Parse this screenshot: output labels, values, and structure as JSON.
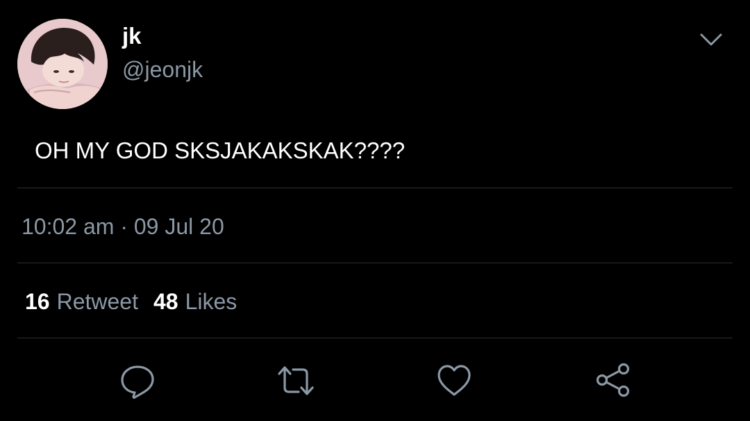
{
  "user": {
    "display_name": "jk",
    "handle": "@jeonjk",
    "avatar_icon": "profile-photo"
  },
  "tweet": {
    "text": "OH MY GOD SKSJAKAKSKAK????"
  },
  "meta": {
    "time": "10:02 am",
    "separator": "·",
    "date": "09 Jul 20"
  },
  "stats": {
    "retweet_count": "16",
    "retweet_label": "Retweet",
    "like_count": "48",
    "like_label": "Likes"
  },
  "actions": [
    {
      "icon": "reply-icon"
    },
    {
      "icon": "retweet-icon"
    },
    {
      "icon": "like-icon"
    },
    {
      "icon": "share-icon"
    }
  ],
  "colors": {
    "background": "#000000",
    "text_primary": "#ffffff",
    "text_secondary": "#8b98a5",
    "divider": "#2a2f33"
  }
}
